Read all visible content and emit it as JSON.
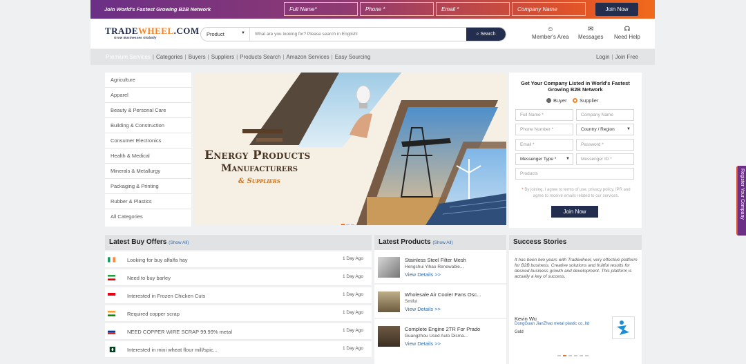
{
  "topbar": {
    "tagline": "Join World's Fastest Growing B2B Network",
    "fields": [
      "Full Name*",
      "Phone *",
      "Email *",
      "Company Name"
    ],
    "button": "Join Now"
  },
  "header": {
    "logo_part1": "TRADE",
    "logo_part2": "WHEEL",
    "logo_part3": ".COM",
    "logo_tagline": "Grow Businesses Globally",
    "search_category": "Product",
    "search_placeholder": "What are you looking for? Please search in English!",
    "search_button": "Search",
    "member_area": "Member's Area",
    "messages": "Messages",
    "need_help": "Need Help"
  },
  "nav": {
    "items": [
      "Premium Services",
      "Categories",
      "Buyers",
      "Suppliers",
      "Products Search",
      "Amazon Services",
      "Easy Sourcing"
    ],
    "login": "Login",
    "join": "Join Free"
  },
  "categories": [
    "Agriculture",
    "Apparel",
    "Beauty & Personal Care",
    "Building & Construction",
    "Consumer Electronics",
    "Health & Medical",
    "Minerals & Metallurgy",
    "Packaging & Printing",
    "Rubber & Plastics",
    "All Categories"
  ],
  "banner": {
    "line1": "Energy Products",
    "line2": "Manufacturers",
    "line3": "& Suppliers"
  },
  "listing_form": {
    "title": "Get Your Company Listed in World's Fastest Growing B2B Network",
    "radio_buyer": "Buyer",
    "radio_supplier": "Supplier",
    "full_name": "Full Name *",
    "company_name": "Company Name",
    "phone": "Phone Number *",
    "country": "Country / Region",
    "email": "Email *",
    "password": "Password *",
    "messenger_type": "Messenger Type *",
    "messenger_id": "Messenger ID *",
    "products": "Products",
    "note_star": "*",
    "note": " By joining, I agree to terms of use, privacy policy, IPR and agree to receive emails related to our services.",
    "button": "Join Now"
  },
  "buy_offers": {
    "title": "Latest Buy Offers",
    "show_all": "(Show All)",
    "rows": [
      {
        "text": "Looking for buy alfalfa hay",
        "date": "1 Day Ago",
        "flag": "ireland"
      },
      {
        "text": "Need to buy barley",
        "date": "1 Day Ago",
        "flag": "iran"
      },
      {
        "text": "Interested in Frozen Chicken Cuts",
        "date": "1 Day Ago",
        "flag": "indonesia"
      },
      {
        "text": "Required copper scrap",
        "date": "1 Day Ago",
        "flag": "india"
      },
      {
        "text": "NEED COPPER WIRE SCRAP 99.99% metal",
        "date": "1 Day Ago",
        "flag": "russia"
      },
      {
        "text": "Interested in mini wheat flour mill/spic...",
        "date": "1 Day Ago",
        "flag": "pakistan"
      }
    ]
  },
  "latest_products": {
    "title": "Latest Products",
    "show_all": "(Show All)",
    "items": [
      {
        "name": "Stainless Steel Filter Mesh",
        "seller": "Hengshui Yihao Renewable...",
        "link": "View Details >>"
      },
      {
        "name": "Wholesale Air Cooler Fans Osc...",
        "seller": "Smiful",
        "link": "View Details >>"
      },
      {
        "name": "Complete Engine 2TR For Prado",
        "seller": "Guangzhou Used Auto Disma...",
        "link": "View Details >>"
      }
    ]
  },
  "success": {
    "title": "Success Stories",
    "quote": "It has been two years with Tradewheel, very effective platform for B2B business. Creative solutions and fruitful results for desired business growth and development. This platform is actually a key of success.",
    "name": "Kevin Wu",
    "company": "DongGuan JianZhao metal plastic co.,ltd",
    "tier": "Gold"
  },
  "side_tab": "Register Your Company",
  "colors": {
    "navy": "#232e4e",
    "orange": "#f58220",
    "purple": "#6b2f86"
  }
}
